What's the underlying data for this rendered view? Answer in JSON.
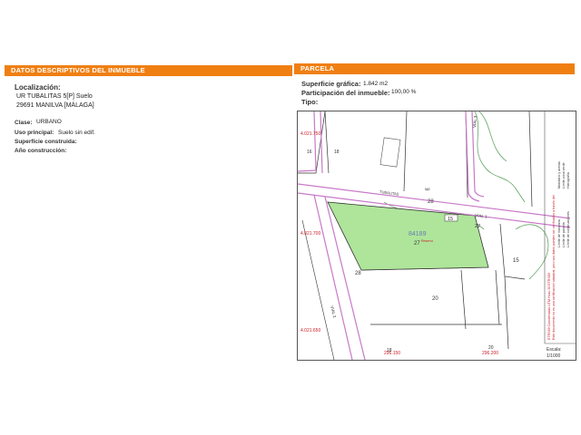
{
  "left_panel": {
    "header": "DATOS DESCRIPTIVOS DEL INMUEBLE",
    "localizacion_label": "Localización:",
    "localizacion_line1": "UR TUBALITAS 5[P] Suelo",
    "localizacion_line2": "29691 MANILVA [MÁLAGA]",
    "clase_label": "Clase:",
    "clase_value": "URBANO",
    "uso_label": "Uso principal:",
    "uso_value": "Suelo sin edif.",
    "superficie_label": "Superficie construida:",
    "ano_label": "Año construcción:"
  },
  "right_panel": {
    "header": "PARCELA",
    "superficie_label": "Superficie gráfica:",
    "superficie_value": "1.842 m2",
    "participacion_label": "Participación del inmueble:",
    "participacion_value": "100,00 %",
    "tipo_label": "Tipo:"
  },
  "map": {
    "coord_top": "4.021.750",
    "coord_mid": "4.021.700",
    "coord_bottom": "4.021.650",
    "coord_x_left": "296.150",
    "coord_x_right": "296.200",
    "via_label_top": "VIAL 3",
    "via_label_1": "VIAL 1",
    "via_label_2": "VIAL 2",
    "road_label_a": "TUBALITAS",
    "road_label_b": "MF",
    "parcel_id": "84189",
    "parcel_num": "27",
    "parcel_tag": "Reservo",
    "num_28_top": "28",
    "num_28_left": "28",
    "num_20": "20",
    "num_15_top": "15",
    "num_22": "22",
    "num_15_right": "15",
    "num_18": "18",
    "num_18_bottom": "18",
    "num_16": "16",
    "num_20_bottom": "20",
    "escala_label": "Escala:",
    "escala_value": "1/1000",
    "side_text_1": "Este documento no es una certificación catastral, pero sus datos pueden ser verificados a través del",
    "side_text_2": "ETRS89 Coordenadas UTM Huso 30 ETRS89",
    "legend_1": "Límite de manzana",
    "legend_2": "Límite de parcela",
    "legend_3": "Límite de construcciones",
    "legend_4": "Mobiliario y aceras",
    "legend_5": "Límite zona verde",
    "legend_6": "Hidrografía",
    "colors": {
      "header": "#f07f12",
      "parcel_fill": "#aee59a",
      "road": "#c879c8",
      "lines": "#333333",
      "red_text": "#d0202b",
      "green_contour": "#4f9a4f"
    }
  }
}
